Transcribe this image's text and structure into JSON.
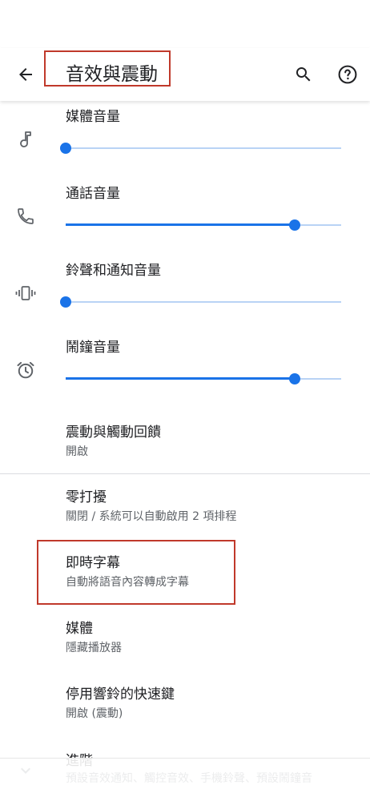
{
  "header": {
    "title": "音效與震動"
  },
  "volume_sliders": [
    {
      "label": "媒體音量",
      "icon": "music-note-icon",
      "level": 0
    },
    {
      "label": "通話音量",
      "icon": "phone-icon",
      "level": 0.83
    },
    {
      "label": "鈴聲和通知音量",
      "icon": "vibrate-icon",
      "level": 0
    },
    {
      "label": "鬧鐘音量",
      "icon": "alarm-icon",
      "level": 0.83
    }
  ],
  "settings": [
    {
      "title": "震動與觸動回饋",
      "summary": "開啟"
    },
    {
      "title": "零打擾",
      "summary": "關閉 / 系統可以自動啟用 2 項排程"
    },
    {
      "title": "即時字幕",
      "summary": "自動將語音內容轉成字幕"
    },
    {
      "title": "媒體",
      "summary": "隱藏播放器"
    },
    {
      "title": "停用響鈴的快速鍵",
      "summary": "開啟 (震動)"
    }
  ],
  "advanced": {
    "title": "進階",
    "summary": "預設音效通知、觸控音效、手機鈴聲、預設鬧鐘音"
  },
  "colors": {
    "accent": "#1a73e8",
    "accent_track": "#b9d3f5",
    "highlight_box": "#c0392b",
    "text_primary": "#202124",
    "text_secondary": "#5f6368"
  }
}
